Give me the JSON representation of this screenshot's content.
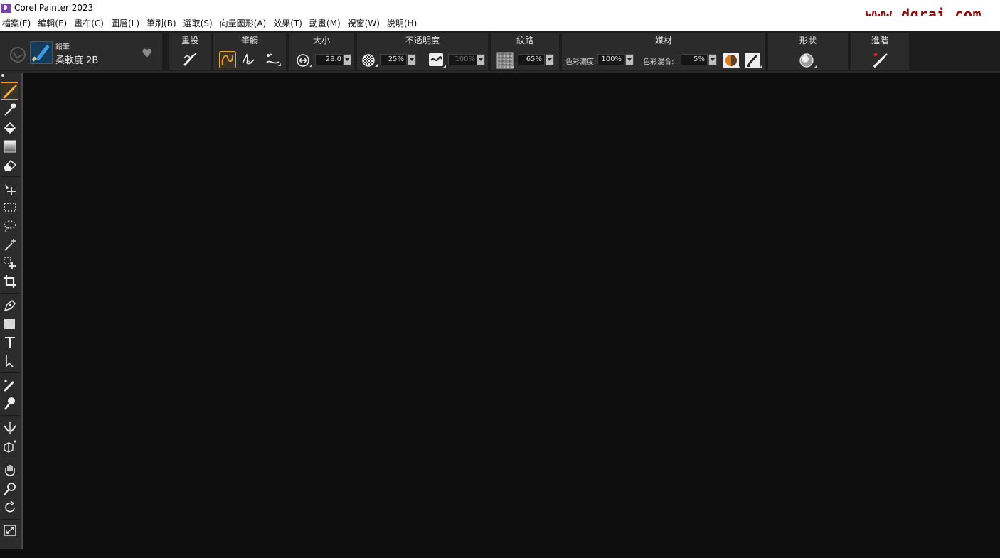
{
  "window": {
    "title": "Corel Painter 2023",
    "watermark": "www.dgrai.com"
  },
  "menu": [
    "檔案(F)",
    "編輯(E)",
    "畫布(C)",
    "圖層(L)",
    "筆刷(B)",
    "選取(S)",
    "向量圖形(A)",
    "效果(T)",
    "動畫(M)",
    "視窗(W)",
    "說明(H)"
  ],
  "brush": {
    "category": "鉛筆",
    "variant": "柔軟度 2B"
  },
  "sections": {
    "reset": "重設",
    "stroke": "筆觸",
    "size": "大小",
    "opacity": "不透明度",
    "grain": "紋路",
    "media": "媒材",
    "shape": "形狀",
    "advanced": "進階"
  },
  "values": {
    "size": "28.0",
    "opacity": "25%",
    "opacity_expression": "100%",
    "grain": "65%",
    "color_concentration_label": "色彩濃度:",
    "color_concentration": "100%",
    "color_mix_label": "色彩混合:",
    "color_mix": "5%"
  },
  "icons": {
    "reset": "brush-reset-icon",
    "stroke_freehand": "freehand-stroke-icon",
    "stroke_straight": "straight-line-stroke-icon",
    "stroke_dab": "dab-stroke-icon",
    "size_icon": "size-expression-icon",
    "opacity_icon": "opacity-expression-icon",
    "grain_icon": "paper-grain-icon",
    "color_variability": "color-variability-icon",
    "blending": "blending-icon",
    "shape": "dab-shape-icon",
    "advanced": "advanced-brush-icon"
  },
  "colors": {
    "accent": "#f0a030",
    "watermark": "#8b0a0a",
    "panel": "#2b2b2b",
    "canvas": "#0e0e0e"
  }
}
